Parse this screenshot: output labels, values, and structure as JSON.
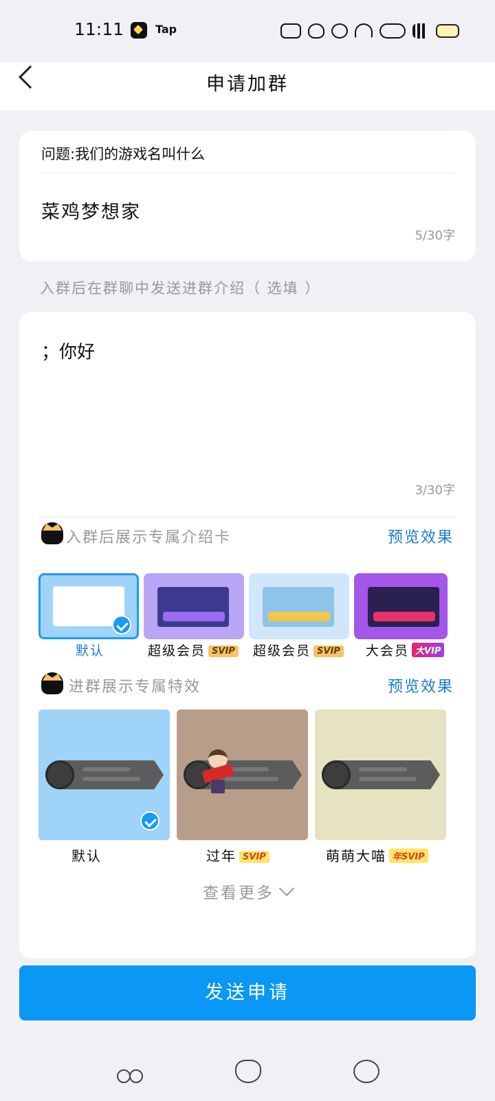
{
  "status_bar": {
    "time": "11:11",
    "app_label": "Tap",
    "icons": [
      "nfc-icon",
      "cat-icon",
      "heart-icon",
      "wifi-icon",
      "hd-icon",
      "5g-signal-icon",
      "battery-icon"
    ]
  },
  "header": {
    "title": "申请加群",
    "back_icon": "back-arrow-icon"
  },
  "question": {
    "label": "问题:我们的游戏名叫什么",
    "answer": "菜鸡梦想家",
    "count": "5/30字"
  },
  "intro": {
    "hint": "入群后在群聊中发送进群介绍（ 选填 ）",
    "text": "；你好",
    "count": "3/30字"
  },
  "card_section": {
    "title": "入群后展示专属介绍卡",
    "preview": "预览效果",
    "options": [
      {
        "label": "默认",
        "badge": "",
        "selected": true,
        "color": "#9fd3f7"
      },
      {
        "label": "超级会员",
        "badge": "SVIP",
        "selected": false,
        "color": "#b9a6f5"
      },
      {
        "label": "超级会员",
        "badge": "SVIP",
        "selected": false,
        "color": "#cfe6fb"
      },
      {
        "label": "大会员",
        "badge": "大VIP",
        "selected": false,
        "color": "#a257e8"
      }
    ]
  },
  "effect_section": {
    "title": "进群展示专属特效",
    "preview": "预览效果",
    "options": [
      {
        "label": "默认",
        "badge": "",
        "selected": true,
        "color": "#9fd3f7"
      },
      {
        "label": "过年",
        "badge": "SVIP",
        "selected": false,
        "color": "#b89e8a"
      },
      {
        "label": "萌萌大喵",
        "badge": "年SVIP",
        "selected": false,
        "color": "#e6e3c2"
      }
    ]
  },
  "more": "查看更多",
  "send_button": "发送申请",
  "nav": [
    "bike-icon",
    "strawberry-icon",
    "cloud-icon"
  ],
  "colors": {
    "accent": "#0a97f5",
    "link": "#1a7ad6"
  }
}
